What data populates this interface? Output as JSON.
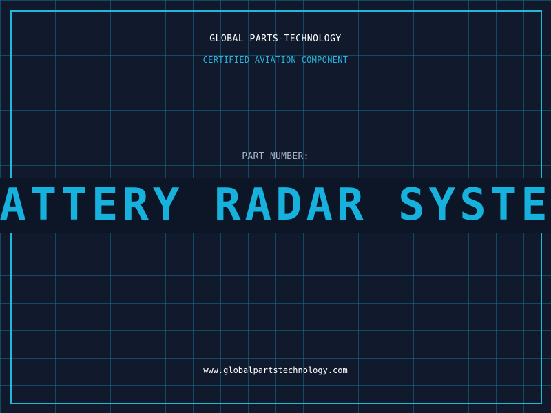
{
  "header": {
    "company": "GLOBAL PARTS-TECHNOLOGY",
    "subtitle": "CERTIFIED AVIATION COMPONENT"
  },
  "main": {
    "part_label": "PART NUMBER:",
    "part_name": "BATTERY RADAR SYSTEM"
  },
  "footer": {
    "url": "www.globalpartstechnology.com"
  },
  "colors": {
    "background": "#101a2c",
    "accent": "#16b1dc",
    "frame": "#22b7d8",
    "grid": "#1a6e8c"
  }
}
